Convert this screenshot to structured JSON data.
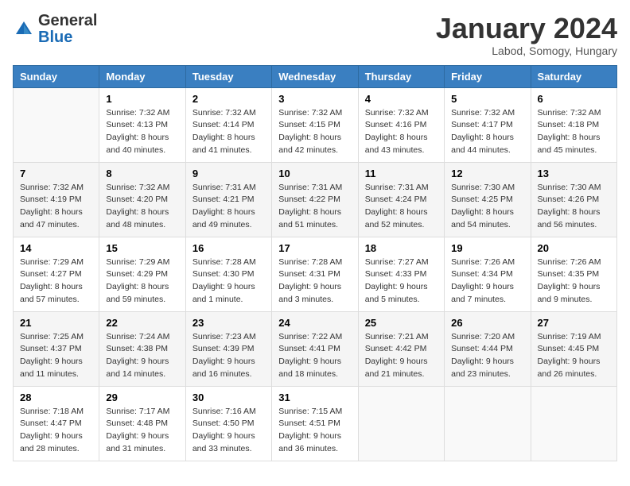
{
  "logo": {
    "text_general": "General",
    "text_blue": "Blue"
  },
  "title": {
    "month_year": "January 2024",
    "location": "Labod, Somogy, Hungary"
  },
  "days_of_week": [
    "Sunday",
    "Monday",
    "Tuesday",
    "Wednesday",
    "Thursday",
    "Friday",
    "Saturday"
  ],
  "weeks": [
    [
      {
        "day": "",
        "sunrise": "",
        "sunset": "",
        "daylight": ""
      },
      {
        "day": "1",
        "sunrise": "Sunrise: 7:32 AM",
        "sunset": "Sunset: 4:13 PM",
        "daylight": "Daylight: 8 hours and 40 minutes."
      },
      {
        "day": "2",
        "sunrise": "Sunrise: 7:32 AM",
        "sunset": "Sunset: 4:14 PM",
        "daylight": "Daylight: 8 hours and 41 minutes."
      },
      {
        "day": "3",
        "sunrise": "Sunrise: 7:32 AM",
        "sunset": "Sunset: 4:15 PM",
        "daylight": "Daylight: 8 hours and 42 minutes."
      },
      {
        "day": "4",
        "sunrise": "Sunrise: 7:32 AM",
        "sunset": "Sunset: 4:16 PM",
        "daylight": "Daylight: 8 hours and 43 minutes."
      },
      {
        "day": "5",
        "sunrise": "Sunrise: 7:32 AM",
        "sunset": "Sunset: 4:17 PM",
        "daylight": "Daylight: 8 hours and 44 minutes."
      },
      {
        "day": "6",
        "sunrise": "Sunrise: 7:32 AM",
        "sunset": "Sunset: 4:18 PM",
        "daylight": "Daylight: 8 hours and 45 minutes."
      }
    ],
    [
      {
        "day": "7",
        "sunrise": "Sunrise: 7:32 AM",
        "sunset": "Sunset: 4:19 PM",
        "daylight": "Daylight: 8 hours and 47 minutes."
      },
      {
        "day": "8",
        "sunrise": "Sunrise: 7:32 AM",
        "sunset": "Sunset: 4:20 PM",
        "daylight": "Daylight: 8 hours and 48 minutes."
      },
      {
        "day": "9",
        "sunrise": "Sunrise: 7:31 AM",
        "sunset": "Sunset: 4:21 PM",
        "daylight": "Daylight: 8 hours and 49 minutes."
      },
      {
        "day": "10",
        "sunrise": "Sunrise: 7:31 AM",
        "sunset": "Sunset: 4:22 PM",
        "daylight": "Daylight: 8 hours and 51 minutes."
      },
      {
        "day": "11",
        "sunrise": "Sunrise: 7:31 AM",
        "sunset": "Sunset: 4:24 PM",
        "daylight": "Daylight: 8 hours and 52 minutes."
      },
      {
        "day": "12",
        "sunrise": "Sunrise: 7:30 AM",
        "sunset": "Sunset: 4:25 PM",
        "daylight": "Daylight: 8 hours and 54 minutes."
      },
      {
        "day": "13",
        "sunrise": "Sunrise: 7:30 AM",
        "sunset": "Sunset: 4:26 PM",
        "daylight": "Daylight: 8 hours and 56 minutes."
      }
    ],
    [
      {
        "day": "14",
        "sunrise": "Sunrise: 7:29 AM",
        "sunset": "Sunset: 4:27 PM",
        "daylight": "Daylight: 8 hours and 57 minutes."
      },
      {
        "day": "15",
        "sunrise": "Sunrise: 7:29 AM",
        "sunset": "Sunset: 4:29 PM",
        "daylight": "Daylight: 8 hours and 59 minutes."
      },
      {
        "day": "16",
        "sunrise": "Sunrise: 7:28 AM",
        "sunset": "Sunset: 4:30 PM",
        "daylight": "Daylight: 9 hours and 1 minute."
      },
      {
        "day": "17",
        "sunrise": "Sunrise: 7:28 AM",
        "sunset": "Sunset: 4:31 PM",
        "daylight": "Daylight: 9 hours and 3 minutes."
      },
      {
        "day": "18",
        "sunrise": "Sunrise: 7:27 AM",
        "sunset": "Sunset: 4:33 PM",
        "daylight": "Daylight: 9 hours and 5 minutes."
      },
      {
        "day": "19",
        "sunrise": "Sunrise: 7:26 AM",
        "sunset": "Sunset: 4:34 PM",
        "daylight": "Daylight: 9 hours and 7 minutes."
      },
      {
        "day": "20",
        "sunrise": "Sunrise: 7:26 AM",
        "sunset": "Sunset: 4:35 PM",
        "daylight": "Daylight: 9 hours and 9 minutes."
      }
    ],
    [
      {
        "day": "21",
        "sunrise": "Sunrise: 7:25 AM",
        "sunset": "Sunset: 4:37 PM",
        "daylight": "Daylight: 9 hours and 11 minutes."
      },
      {
        "day": "22",
        "sunrise": "Sunrise: 7:24 AM",
        "sunset": "Sunset: 4:38 PM",
        "daylight": "Daylight: 9 hours and 14 minutes."
      },
      {
        "day": "23",
        "sunrise": "Sunrise: 7:23 AM",
        "sunset": "Sunset: 4:39 PM",
        "daylight": "Daylight: 9 hours and 16 minutes."
      },
      {
        "day": "24",
        "sunrise": "Sunrise: 7:22 AM",
        "sunset": "Sunset: 4:41 PM",
        "daylight": "Daylight: 9 hours and 18 minutes."
      },
      {
        "day": "25",
        "sunrise": "Sunrise: 7:21 AM",
        "sunset": "Sunset: 4:42 PM",
        "daylight": "Daylight: 9 hours and 21 minutes."
      },
      {
        "day": "26",
        "sunrise": "Sunrise: 7:20 AM",
        "sunset": "Sunset: 4:44 PM",
        "daylight": "Daylight: 9 hours and 23 minutes."
      },
      {
        "day": "27",
        "sunrise": "Sunrise: 7:19 AM",
        "sunset": "Sunset: 4:45 PM",
        "daylight": "Daylight: 9 hours and 26 minutes."
      }
    ],
    [
      {
        "day": "28",
        "sunrise": "Sunrise: 7:18 AM",
        "sunset": "Sunset: 4:47 PM",
        "daylight": "Daylight: 9 hours and 28 minutes."
      },
      {
        "day": "29",
        "sunrise": "Sunrise: 7:17 AM",
        "sunset": "Sunset: 4:48 PM",
        "daylight": "Daylight: 9 hours and 31 minutes."
      },
      {
        "day": "30",
        "sunrise": "Sunrise: 7:16 AM",
        "sunset": "Sunset: 4:50 PM",
        "daylight": "Daylight: 9 hours and 33 minutes."
      },
      {
        "day": "31",
        "sunrise": "Sunrise: 7:15 AM",
        "sunset": "Sunset: 4:51 PM",
        "daylight": "Daylight: 9 hours and 36 minutes."
      },
      {
        "day": "",
        "sunrise": "",
        "sunset": "",
        "daylight": ""
      },
      {
        "day": "",
        "sunrise": "",
        "sunset": "",
        "daylight": ""
      },
      {
        "day": "",
        "sunrise": "",
        "sunset": "",
        "daylight": ""
      }
    ]
  ]
}
